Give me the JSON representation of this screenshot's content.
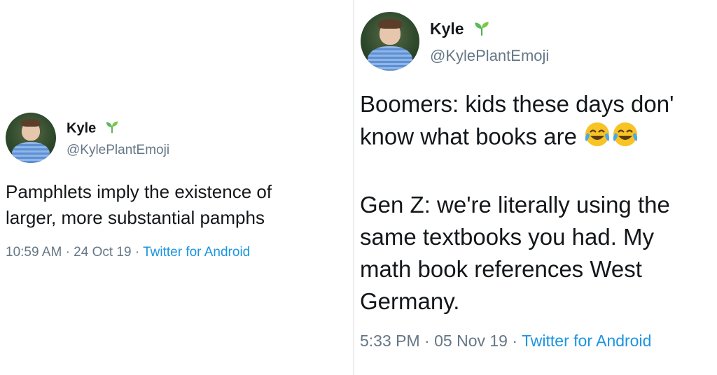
{
  "tweets": [
    {
      "name": "Kyle",
      "handle": "@KylePlantEmoji",
      "text_lines": [
        "Pamphlets imply the existence of",
        "larger, more substantial pamphs"
      ],
      "time": "10:59 AM",
      "date": "24 Oct 19",
      "source": "Twitter for Android",
      "name_emoji": "seedling-icon"
    },
    {
      "name": "Kyle",
      "handle": "@KylePlantEmoji",
      "text_lines": [
        "Boomers: kids these days don'",
        "know what books are",
        "",
        "Gen Z: we're literally using the",
        "same textbooks you had.  My",
        "math book references West",
        "Germany."
      ],
      "time": "5:33 PM",
      "date": "05 Nov 19",
      "source": "Twitter for Android",
      "name_emoji": "seedling-icon",
      "text_emoji": [
        "tears-of-joy-icon",
        "tears-of-joy-icon"
      ]
    }
  ],
  "separator": "·",
  "colors": {
    "text": "#14171a",
    "secondary": "#657786",
    "link": "#1b95e0",
    "sprout": "#4caf50"
  }
}
